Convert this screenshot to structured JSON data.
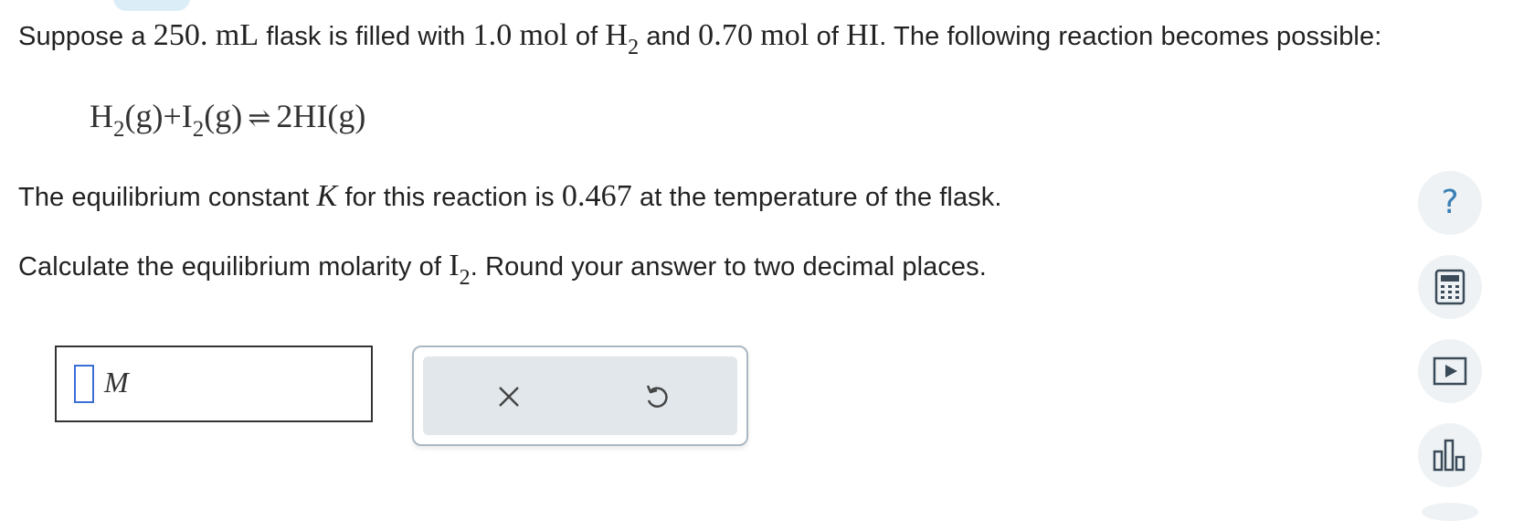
{
  "problem": {
    "line1": {
      "t1": "Suppose a ",
      "volume": "250.",
      "t2": " ",
      "volume_unit": "mL",
      "t3": " flask is filled with ",
      "h2_amount": "1.0",
      "t4": " ",
      "mol1": "mol",
      "t5": " of ",
      "h2_symbol": "H",
      "h2_sub": "2",
      "t6": " and ",
      "hi_amount": "0.70",
      "t7": " ",
      "mol2": "mol",
      "t8": " of ",
      "hi_symbol": "HI",
      "t9": ". The following reaction becomes possible:"
    },
    "equation": {
      "h": "H",
      "h_sub": "2",
      "g1": "(g)",
      "plus": "+",
      "i": "I",
      "i_sub": "2",
      "g2": "(g)",
      "arrow": "⇌",
      "product": "2HI",
      "g3": "(g)"
    },
    "line3": {
      "t1": "The equilibrium constant ",
      "k": "K",
      "t2": " for this reaction is ",
      "k_value": "0.467",
      "t3": " at the temperature of the flask."
    },
    "line4": {
      "t1": "Calculate the equilibrium molarity of ",
      "i_symbol": "I",
      "i_sub": "2",
      "t2": ". Round your answer to two decimal places."
    }
  },
  "answer": {
    "value": "",
    "unit": "M"
  },
  "tools": {
    "clear_icon": "x-icon",
    "undo_icon": "undo-icon"
  },
  "sidebar": {
    "help_label": "?",
    "icons": [
      "help-icon",
      "calculator-icon",
      "video-icon",
      "chart-icon"
    ]
  },
  "colors": {
    "accent": "#3a7fb5",
    "input_border": "#3a6fd8",
    "tool_bg": "#e1e7eb",
    "side_bg": "#eef2f4"
  }
}
